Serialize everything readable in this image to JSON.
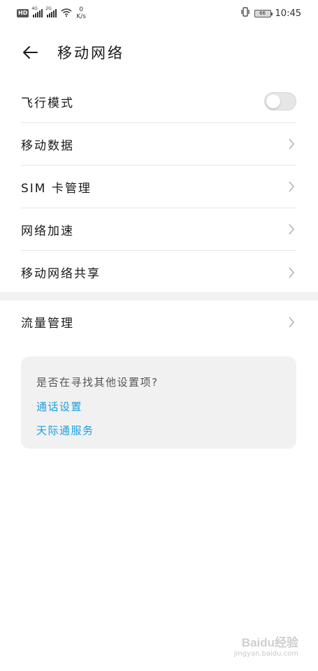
{
  "status_bar": {
    "hd": "HD",
    "sig1_gen": "4G",
    "sig2_gen": "2G",
    "speed_value": "0",
    "speed_unit": "K/s",
    "battery": "66",
    "time": "10:45"
  },
  "header": {
    "title": "移动网络",
    "back_icon": "arrow-left-icon"
  },
  "settings": {
    "airplane": {
      "label": "飞行模式",
      "enabled": false
    },
    "items": [
      {
        "label": "移动数据"
      },
      {
        "label": "SIM 卡管理"
      },
      {
        "label": "网络加速"
      },
      {
        "label": "移动网络共享"
      }
    ],
    "traffic": {
      "label": "流量管理"
    }
  },
  "suggestion": {
    "question": "是否在寻找其他设置项?",
    "links": [
      {
        "label": "通话设置"
      },
      {
        "label": "天际通服务"
      }
    ]
  },
  "colors": {
    "link": "#1aa0e0",
    "card_bg": "#f1f1f1",
    "divider": "#e6e6e6"
  },
  "watermark": {
    "brand": "Baidu经验",
    "url": "jingyan.baidu.com"
  }
}
